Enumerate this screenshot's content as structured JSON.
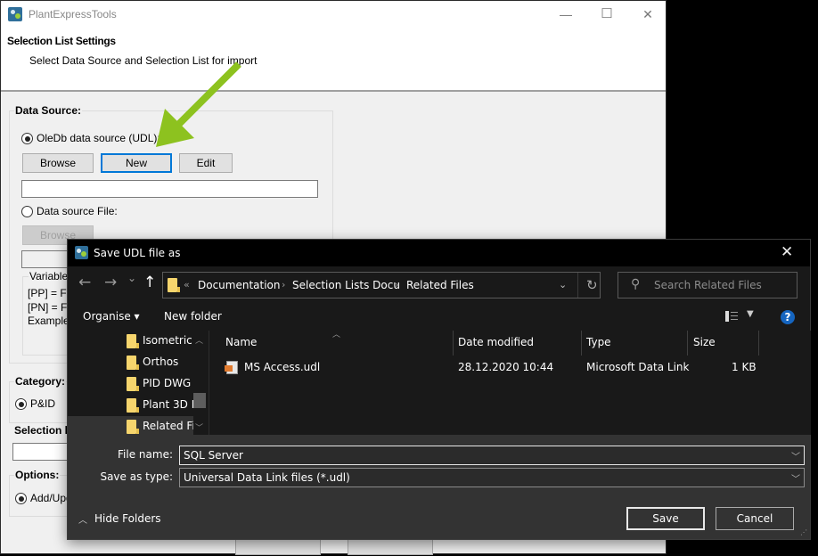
{
  "main_window": {
    "title": "PlantExpressTools",
    "header_title": "Selection List Settings",
    "header_subtitle": "Select Data Source and Selection List for import",
    "controls": {
      "minimize": "—",
      "maximize": "☐",
      "close": "✕"
    },
    "data_source": {
      "group_label": "Data Source:",
      "oledb_label": "OleDb data source (UDL):",
      "oledb_selected": true,
      "buttons": {
        "browse": "Browse",
        "new": "New",
        "edit": "Edit"
      },
      "udl_path_value": "",
      "file_label": "Data source File:",
      "file_selected": false,
      "file_browse": "Browse",
      "file_path_value": "",
      "variables_label": "Variables",
      "variables_lines": [
        "[PP] =   F",
        "[PN] =   F",
        "Example:"
      ]
    },
    "category": {
      "group_label": "Category:",
      "option": "P&ID",
      "selected": true
    },
    "selection_list_label": "Selection li",
    "selection_list_value": "",
    "options": {
      "label": "Options:",
      "option": "Add/Upd",
      "selected": true
    }
  },
  "annotation": {
    "arrow_color": "#8dc21f",
    "points_to": "New"
  },
  "dialog": {
    "title": "Save UDL file as",
    "close_icon": "✕",
    "nav": {
      "back": "←",
      "forward": "→",
      "recent": "⌄",
      "up": "↑"
    },
    "breadcrumb": {
      "overflow": "«",
      "items": [
        "Documentation",
        "Selection Lists Docu",
        "Related Files"
      ],
      "separator": "›"
    },
    "refresh_icon": "↻",
    "search_placeholder": "Search Related Files",
    "toolbar": {
      "organise": "Organise ▾",
      "new_folder": "New folder",
      "view_icon": "details-view",
      "help": "?"
    },
    "tree": [
      {
        "label": "Isometric",
        "selected": false
      },
      {
        "label": "Orthos",
        "selected": false
      },
      {
        "label": "PID DWG",
        "selected": false
      },
      {
        "label": "Plant 3D M",
        "selected": false
      },
      {
        "label": "Related Fil",
        "selected": true
      }
    ],
    "columns": [
      "Name",
      "Date modified",
      "Type",
      "Size"
    ],
    "files": [
      {
        "name": "MS Access.udl",
        "date_modified": "28.12.2020 10:44",
        "type": "Microsoft Data Link",
        "size": "1 KB"
      }
    ],
    "file_name_label": "File name:",
    "file_name_value": "SQL Server",
    "save_type_label": "Save as type:",
    "save_type_value": "Universal Data Link files (*.udl)",
    "hide_folders": "Hide Folders",
    "save_button": "Save",
    "cancel_button": "Cancel"
  }
}
